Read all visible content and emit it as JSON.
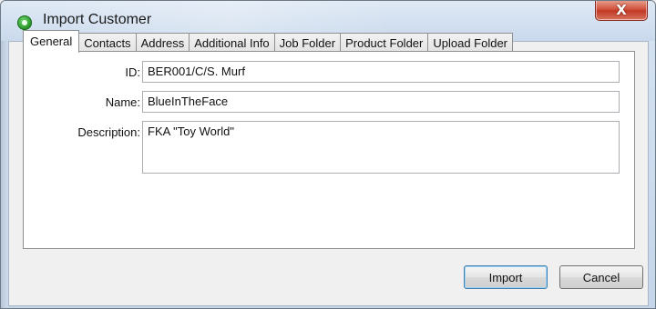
{
  "window": {
    "title": "Import Customer",
    "icon": "app-green-circle-icon",
    "close_label": "X",
    "accent_close": "#c13a26"
  },
  "tabs": [
    {
      "label": "General",
      "active": true
    },
    {
      "label": "Contacts",
      "active": false
    },
    {
      "label": "Address",
      "active": false
    },
    {
      "label": "Additional Info",
      "active": false
    },
    {
      "label": "Job Folder",
      "active": false
    },
    {
      "label": "Product Folder",
      "active": false
    },
    {
      "label": "Upload Folder",
      "active": false
    }
  ],
  "form": {
    "id_label": "ID:",
    "id_value": "BER001/C/S. Murf",
    "name_label": "Name:",
    "name_value": "BlueInTheFace",
    "description_label": "Description:",
    "description_value": "FKA \"Toy World\""
  },
  "buttons": {
    "import_label": "Import",
    "cancel_label": "Cancel"
  }
}
